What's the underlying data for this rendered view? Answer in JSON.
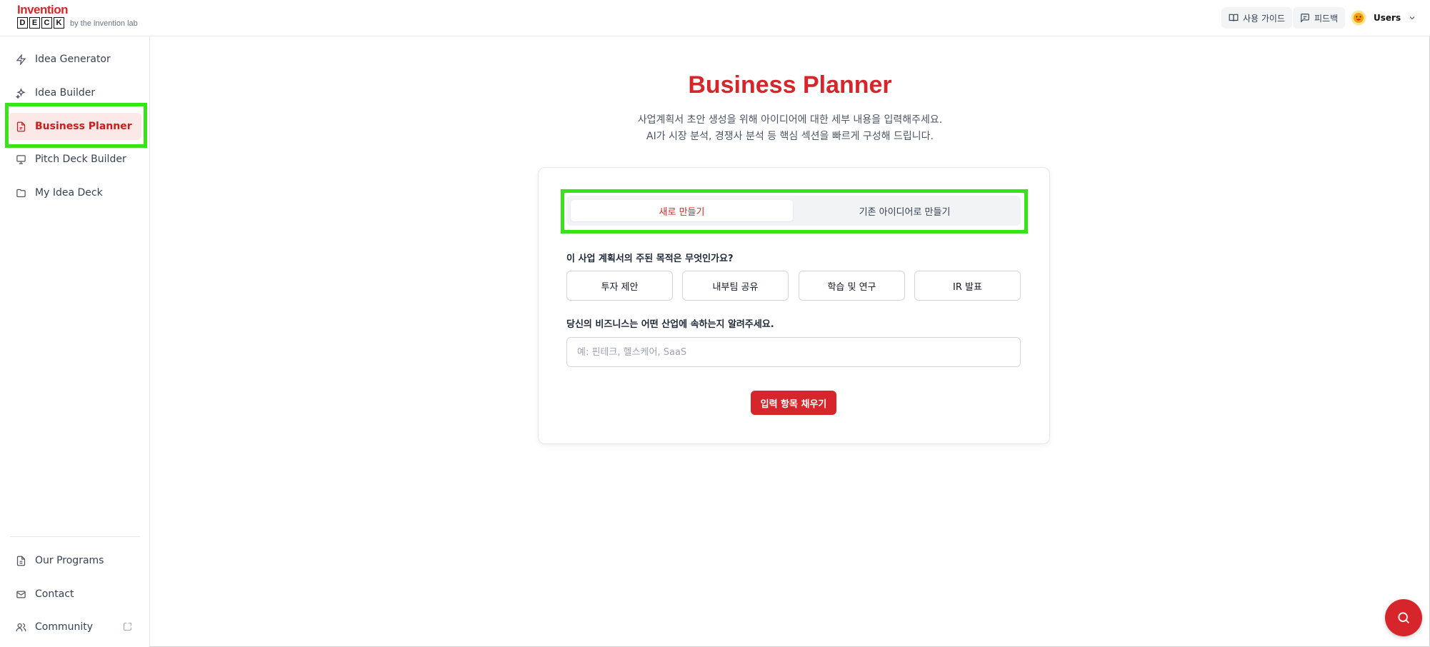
{
  "logo": {
    "top": "Invention",
    "letters": [
      "D",
      "E",
      "C",
      "K"
    ],
    "sub": "by the invention lab"
  },
  "header": {
    "guide_label": "사용 가이드",
    "feedback_label": "피드백",
    "user_label": "Users"
  },
  "sidebar": {
    "items": [
      {
        "label": "Idea Generator",
        "icon": "bolt-icon"
      },
      {
        "label": "Idea Builder",
        "icon": "sparkles-icon"
      },
      {
        "label": "Business Planner",
        "icon": "file-icon"
      },
      {
        "label": "Pitch Deck Builder",
        "icon": "monitor-icon"
      },
      {
        "label": "My Idea Deck",
        "icon": "folder-icon"
      }
    ],
    "bottom": [
      {
        "label": "Our Programs",
        "icon": "document-icon"
      },
      {
        "label": "Contact",
        "icon": "mail-icon"
      },
      {
        "label": "Community",
        "icon": "users-icon"
      }
    ]
  },
  "main": {
    "title": "Business Planner",
    "subtitle_line1": "사업계획서 초안 생성을 위해 아이디어에 대한 세부 내용을 입력해주세요.",
    "subtitle_line2": "AI가 시장 분석, 경쟁사 분석 등 핵심 섹션을 빠르게 구성해 드립니다.",
    "tabs": [
      {
        "label": "새로 만들기",
        "active": true
      },
      {
        "label": "기존 아이디어로 만들기",
        "active": false
      }
    ],
    "purpose_question": "이 사업 계획서의 주된 목적은 무엇인가요?",
    "purpose_options": [
      "투자 제안",
      "내부팀 공유",
      "학습 및 연구",
      "IR 발표"
    ],
    "industry_question": "당신의 비즈니스는 어떤 산업에 속하는지 알려주세요.",
    "industry_placeholder": "예: 핀테크, 헬스케어, SaaS",
    "fill_button": "입력 항목 채우기"
  },
  "colors": {
    "brand": "#d6262b",
    "highlight": "#39e31a"
  }
}
